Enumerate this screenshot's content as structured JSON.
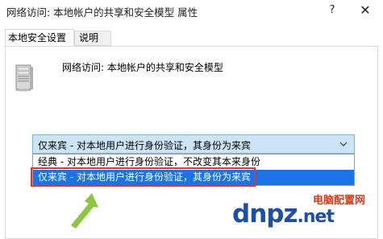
{
  "window": {
    "title": "网络访问: 本地帐户的共享和安全模型 属性",
    "help_label": "?",
    "close_label": "✕"
  },
  "tabs": [
    {
      "label": "本地安全设置",
      "active": true
    },
    {
      "label": "说明",
      "active": false
    }
  ],
  "policy": {
    "icon": "server-icon",
    "name": "网络访问: 本地帐户的共享和安全模型"
  },
  "combo": {
    "selected": "仅来宾 - 对本地用户进行身份验证，其身份为来宾",
    "options": [
      "经典 - 对本地用户进行身份验证，不改变其本来身份",
      "仅来宾 - 对本地用户进行身份验证，其身份为来宾"
    ],
    "highlighted_index": 1
  },
  "watermark": {
    "top_text": "电脑配置网",
    "main_text": "dnpz",
    "suffix_text": ".net"
  },
  "colors": {
    "combo_bg": "#cde4f7",
    "selection": "#1a73e8",
    "highlight_box": "#d9363e",
    "arrow": "#8dc63f",
    "watermark_blue": "#1e4fa8",
    "watermark_red": "#d63b1a"
  }
}
